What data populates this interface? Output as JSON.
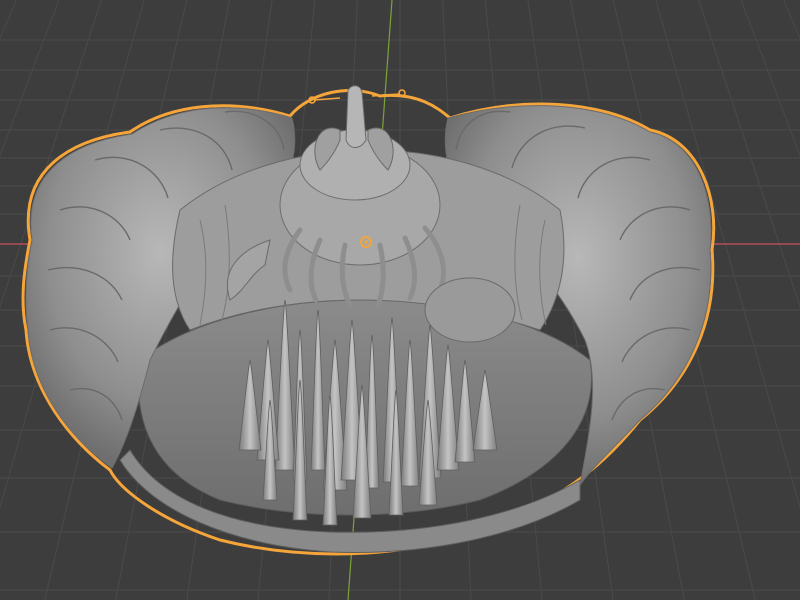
{
  "viewport": {
    "mode": "3d-viewport-solid-shading",
    "background_color": "#3d3d3d",
    "grid_line_color": "#4a4a4a",
    "x_axis_color": "#c8525e",
    "y_axis_color": "#7aa33a",
    "selection_outline_color": "#f5a53a",
    "origin_marker_color": "#f5a53a"
  },
  "scene": {
    "object": {
      "kind": "sculpted-diorama-mesh",
      "selected": true,
      "material_color": "#9a9a9a"
    },
    "icons": {
      "origin": "object-origin-icon",
      "cursor": "3d-cursor-icon"
    }
  }
}
